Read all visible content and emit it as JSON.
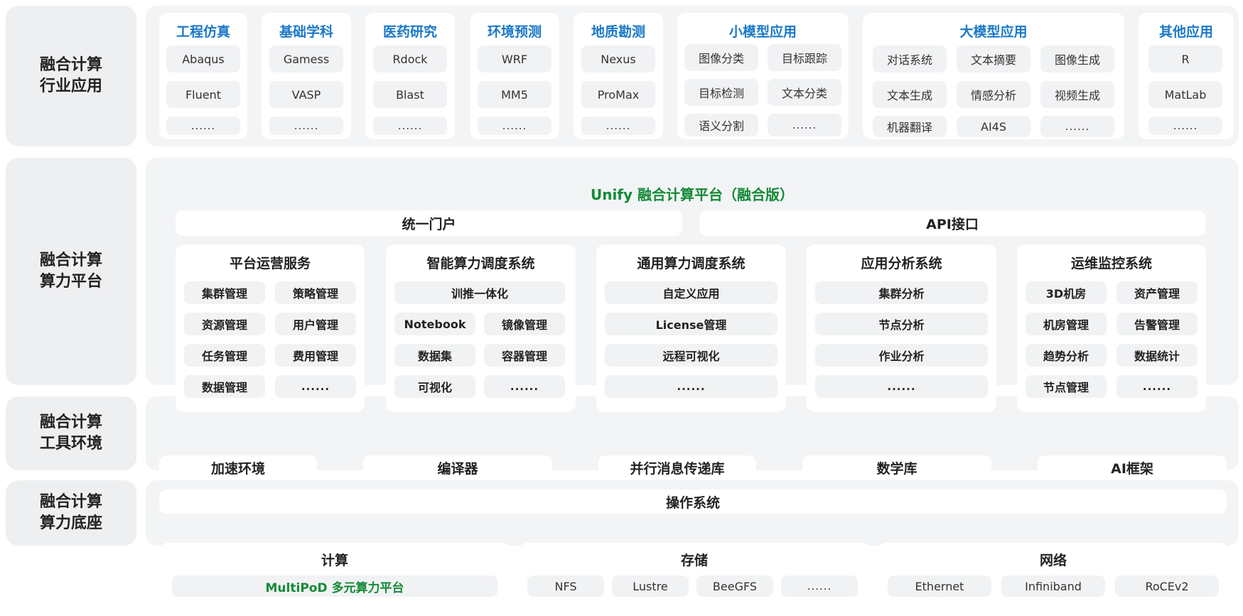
{
  "colors": {
    "accent_blue": "#1b78c8",
    "accent_green": "#138a36",
    "panel_bg": "#f3f4f6",
    "chip_bg": "#f1f2f4"
  },
  "row_labels": [
    [
      "融合计算",
      "行业应用"
    ],
    [
      "融合计算",
      "算力平台"
    ],
    [
      "融合计算",
      "工具环境"
    ],
    [
      "融合计算",
      "算力底座"
    ]
  ],
  "apps": [
    {
      "title": "工程仿真",
      "items": [
        "Abaqus",
        "Fluent",
        "......"
      ]
    },
    {
      "title": "基础学科",
      "items": [
        "Gamess",
        "VASP",
        "......"
      ]
    },
    {
      "title": "医药研究",
      "items": [
        "Rdock",
        "Blast",
        "......"
      ]
    },
    {
      "title": "环境预测",
      "items": [
        "WRF",
        "MM5",
        "......"
      ]
    },
    {
      "title": "地质勘测",
      "items": [
        "Nexus",
        "ProMax",
        "......"
      ]
    },
    {
      "title": "小模型应用",
      "items": [
        "图像分类",
        "目标跟踪",
        "目标检测",
        "文本分类",
        "语义分割",
        "......"
      ]
    },
    {
      "title": "大模型应用",
      "items": [
        "对话系统",
        "文本摘要",
        "图像生成",
        "文本生成",
        "情感分析",
        "视频生成",
        "机器翻译",
        "AI4S",
        "......"
      ]
    },
    {
      "title": "其他应用",
      "items": [
        "R",
        "MatLab",
        "......"
      ]
    }
  ],
  "platform": {
    "title": "Unify 融合计算平台（融合版）",
    "portal": "统一门户",
    "api": "API接口",
    "systems": [
      {
        "title": "平台运营服务",
        "items": [
          "集群管理",
          "策略管理",
          "资源管理",
          "用户管理",
          "任务管理",
          "费用管理",
          "数据管理",
          "......"
        ]
      },
      {
        "title": "智能算力调度系统",
        "items": [
          "训推一体化",
          "Notebook",
          "镜像管理",
          "数据集",
          "容器管理",
          "可视化",
          "......"
        ]
      },
      {
        "title": "通用算力调度系统",
        "items": [
          "自定义应用",
          "License管理",
          "远程可视化",
          "......"
        ]
      },
      {
        "title": "应用分析系统",
        "items": [
          "集群分析",
          "节点分析",
          "作业分析",
          "......"
        ]
      },
      {
        "title": "运维监控系统",
        "items": [
          "3D机房",
          "资产管理",
          "机房管理",
          "告警管理",
          "趋势分析",
          "数据统计",
          "节点管理",
          "......"
        ]
      }
    ]
  },
  "tools": {
    "items": [
      "加速环境",
      "编译器",
      "并行消息传递库",
      "数学库",
      "AI框架"
    ],
    "os": "操作系统"
  },
  "base": {
    "compute": {
      "title": "计算",
      "item": "MultiPoD 多元算力平台"
    },
    "storage": {
      "title": "存储",
      "items": [
        "NFS",
        "Lustre",
        "BeeGFS",
        "......"
      ]
    },
    "network": {
      "title": "网络",
      "items": [
        "Ethernet",
        "Infiniband",
        "RoCEv2"
      ]
    }
  }
}
